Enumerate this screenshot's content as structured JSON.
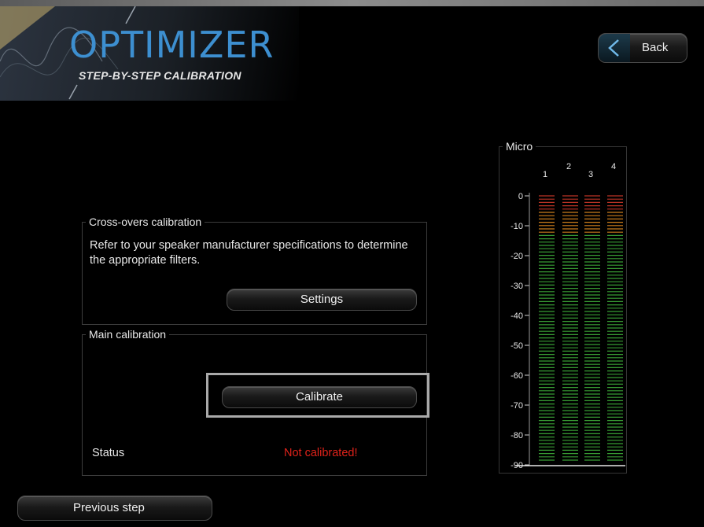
{
  "header": {
    "title": "OPTIMIZER",
    "subtitle": "STEP-BY-STEP CALIBRATION",
    "accent_color": "#3d8fd0"
  },
  "nav": {
    "back_label": "Back",
    "back_icon": "chevron-left-icon",
    "previous_label": "Previous step"
  },
  "crossovers": {
    "title": "Cross-overs calibration",
    "description": "Refer to your speaker manufacturer specifications to determine the appropriate filters.",
    "settings_label": "Settings"
  },
  "main_calibration": {
    "title": "Main calibration",
    "calibrate_label": "Calibrate",
    "status_label": "Status",
    "status_value": "Not calibrated!",
    "status_color": "#e0221a"
  },
  "meter": {
    "title": "Micro",
    "channels": [
      "1",
      "2",
      "3",
      "4"
    ],
    "scale": [
      "0",
      "-10",
      "-20",
      "-30",
      "-40",
      "-50",
      "-60",
      "-70",
      "-80",
      "-90"
    ],
    "colors": {
      "red": "#d23a2a",
      "orange": "#e08a20",
      "green": "#3fae3a"
    }
  }
}
